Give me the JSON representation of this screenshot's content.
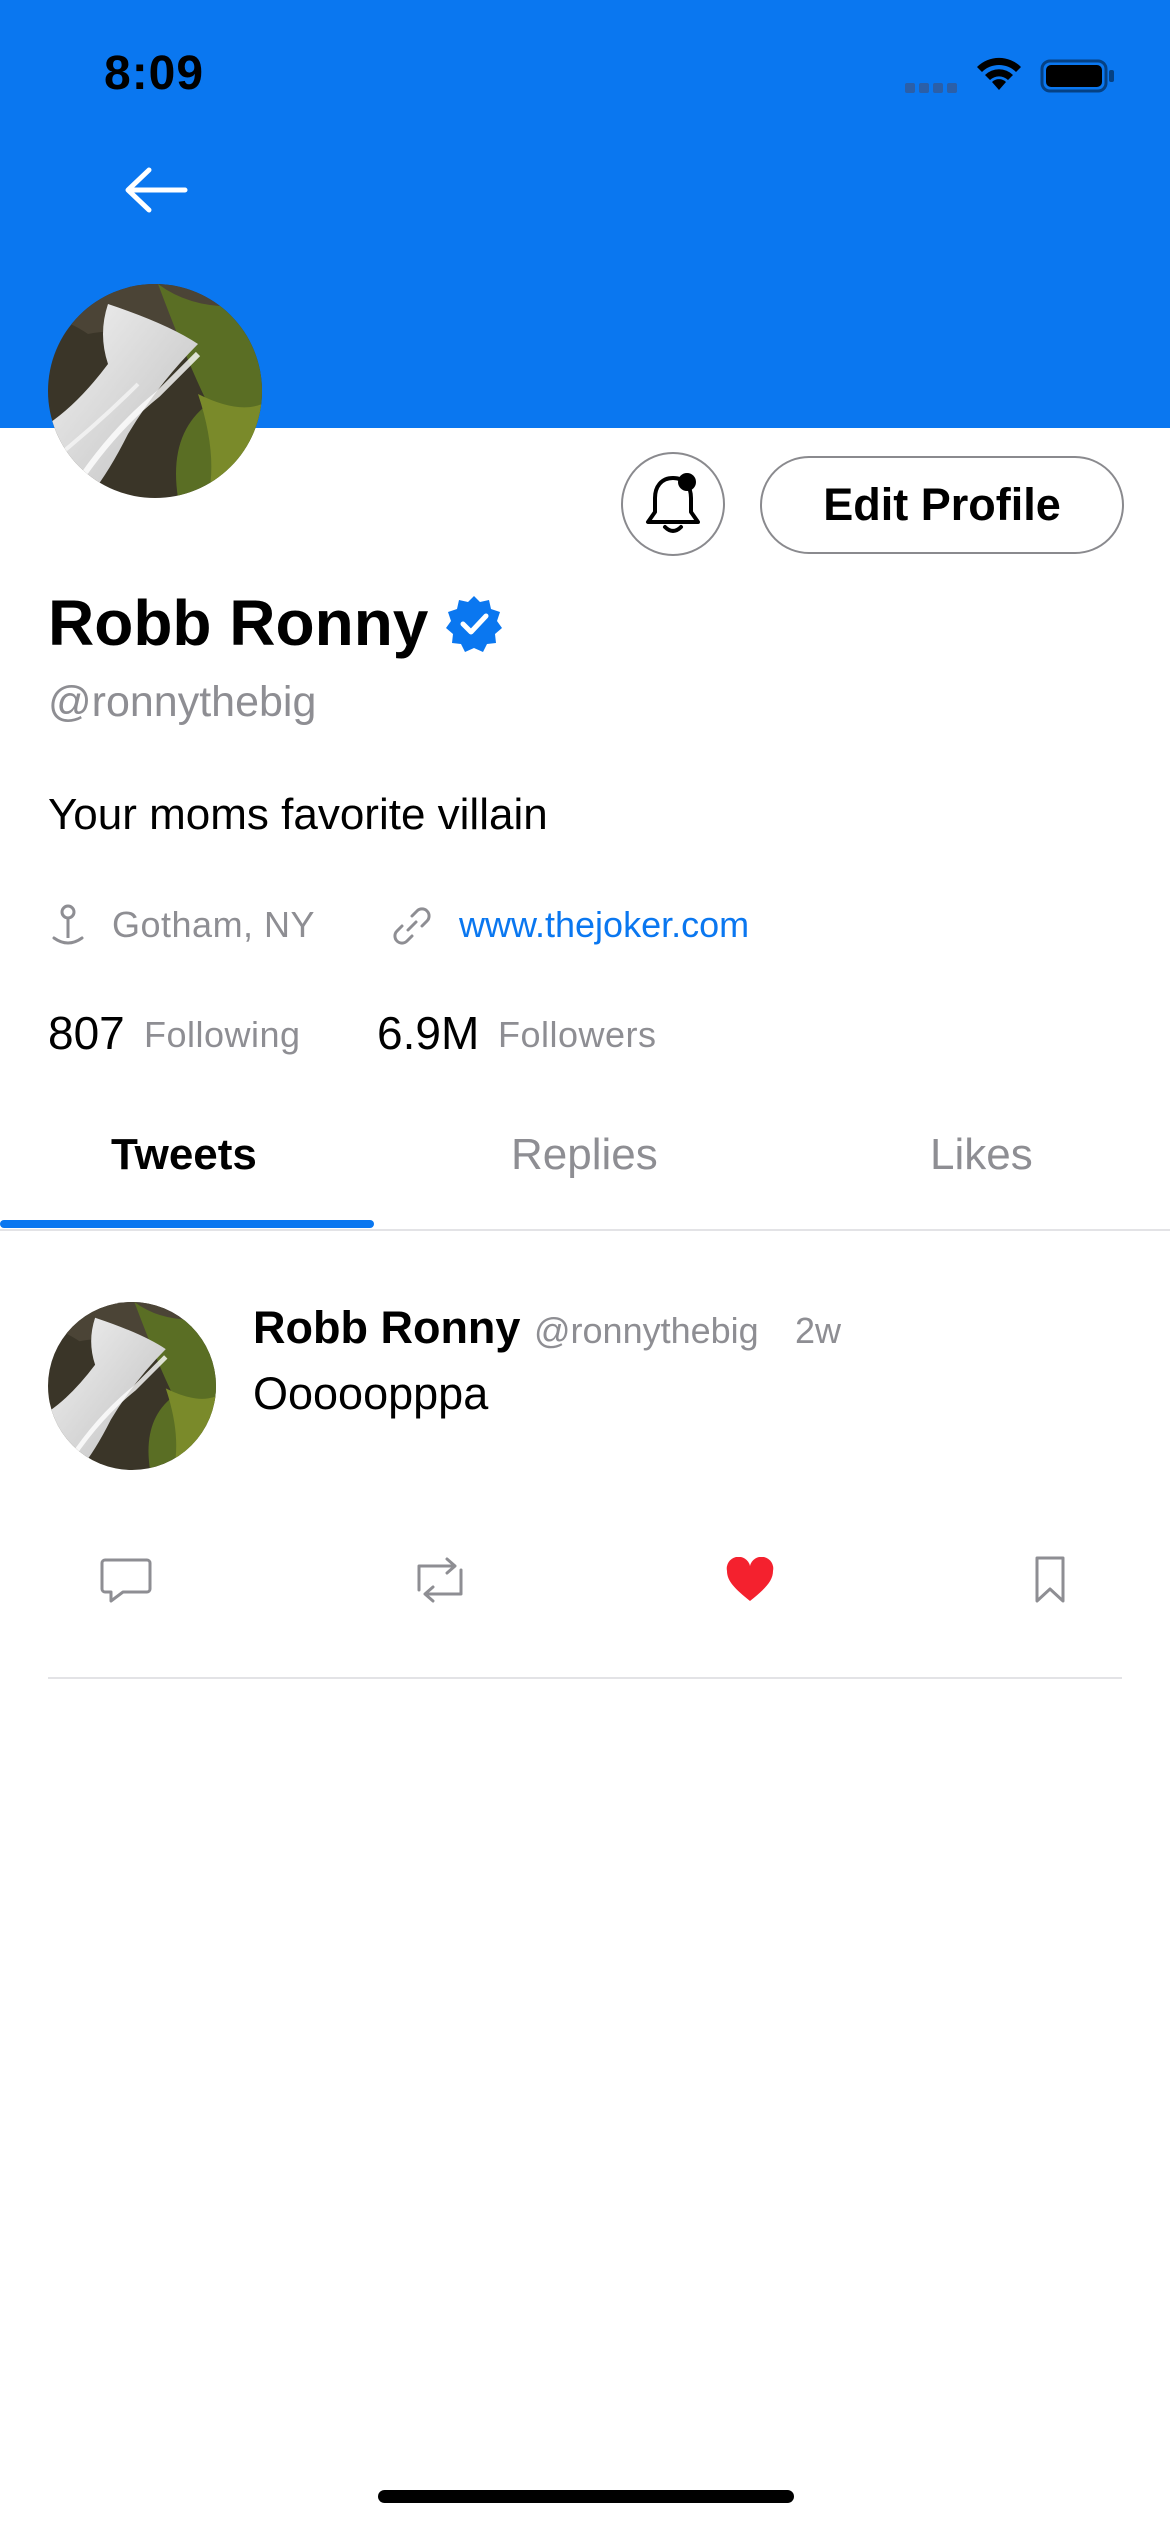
{
  "status_bar": {
    "time": "8:09"
  },
  "profile": {
    "name": "Robb Ronny",
    "handle": "@ronnythebig",
    "bio": "Your moms favorite villain",
    "location": "Gotham, NY",
    "website": "www.thejoker.com",
    "following_count": "807",
    "following_label": "Following",
    "followers_count": "6.9M",
    "followers_label": "Followers",
    "edit_label": "Edit Profile"
  },
  "tabs": [
    {
      "label": "Tweets",
      "active": true
    },
    {
      "label": "Replies",
      "active": false
    },
    {
      "label": "Likes",
      "active": false
    }
  ],
  "tweet": {
    "name": "Robb Ronny",
    "handle": "@ronnythebig",
    "time": "2w",
    "text": "Ooooopppa",
    "liked": true
  },
  "icons": {
    "back": "arrow-left-icon",
    "bell": "bell-icon",
    "verified": "verified-badge-icon",
    "location": "pin-icon",
    "link": "link-icon",
    "reply": "comment-icon",
    "retweet": "retweet-icon",
    "like": "heart-icon",
    "bookmark": "bookmark-icon"
  },
  "colors": {
    "accent": "#0A77F0",
    "secondary_text": "#8e8e93",
    "like": "#F4212E"
  }
}
